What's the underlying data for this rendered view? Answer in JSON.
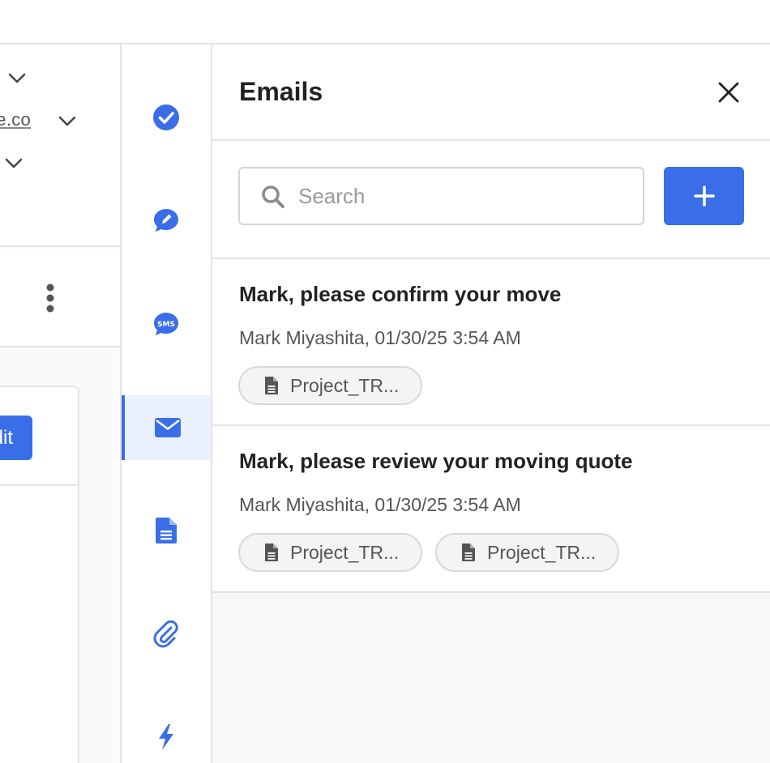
{
  "left_panel": {
    "email_fragment": "ve.co",
    "edit_label": "dit"
  },
  "panel": {
    "title": "Emails",
    "search": {
      "placeholder": "Search",
      "value": ""
    }
  },
  "emails": [
    {
      "subject": "Mark, please confirm your move",
      "meta": "Mark Miyashita, 01/30/25 3:54 AM",
      "attachments": [
        "Project_TR..."
      ]
    },
    {
      "subject": "Mark, please review your moving quote",
      "meta": "Mark Miyashita, 01/30/25 3:54 AM",
      "attachments": [
        "Project_TR...",
        "Project_TR..."
      ]
    }
  ],
  "rail_icons": [
    "check-circle-icon",
    "note-bubble-icon",
    "sms-bubble-icon",
    "envelope-icon",
    "document-icon",
    "paperclip-icon",
    "lightning-icon"
  ],
  "colors": {
    "accent": "#3a6ee8",
    "active_bg": "#e8f1fd",
    "border": "#e3e3e3"
  }
}
